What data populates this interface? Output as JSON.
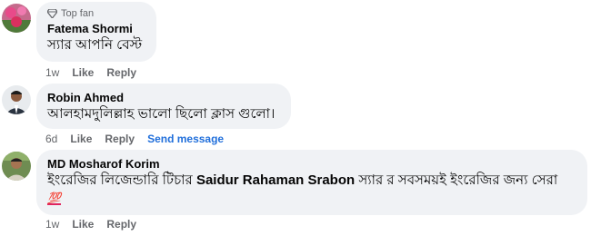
{
  "comments": [
    {
      "badge": "Top fan",
      "author": "Fatema Shormi",
      "text": "স্যার আপনি বেস্ট",
      "time": "1w",
      "like": "Like",
      "reply": "Reply"
    },
    {
      "author": "Robin Ahmed",
      "text": "আলহামদুলিল্লাহ ভালো ছিলো ক্লাস গুলো।",
      "time": "6d",
      "like": "Like",
      "reply": "Reply",
      "send_message": "Send message"
    },
    {
      "author": "MD Mosharof Korim",
      "text_pre": "ইংরেজির লিজেন্ডারি টিচার ",
      "text_bold": "Saidur Rahaman Srabon",
      "text_post": " স্যার র সবসময়ই ইংরেজির জন্য সেরা",
      "emoji": "💯",
      "emoji_name": "hundred-points-icon",
      "time": "1w",
      "like": "Like",
      "reply": "Reply"
    }
  ],
  "colors": {
    "bubble": "#f0f2f5",
    "meta_text": "#65676b",
    "link": "#216fdb",
    "emoji": "#e0245e"
  }
}
